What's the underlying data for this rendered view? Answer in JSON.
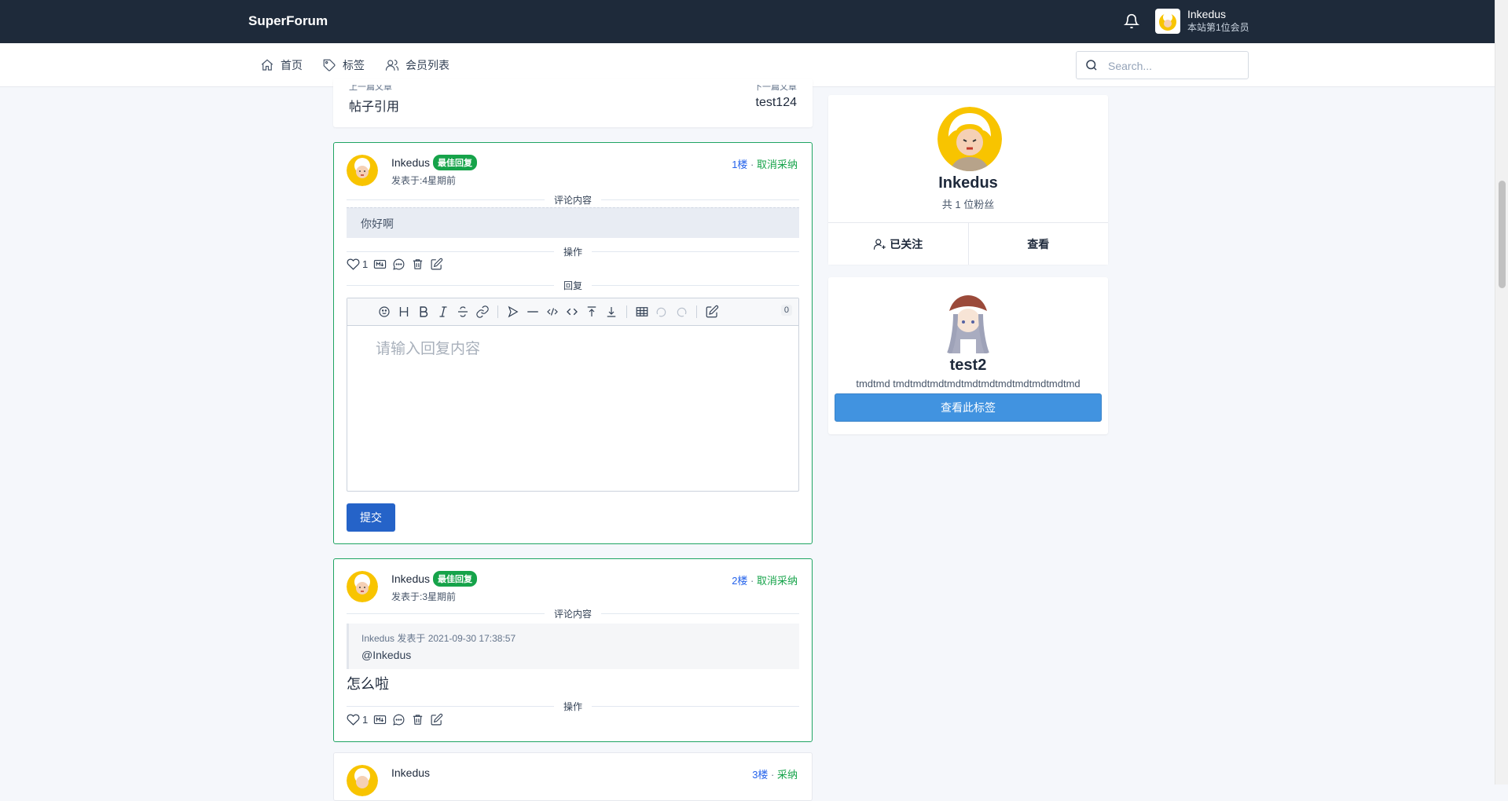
{
  "header": {
    "brand": "SuperForum",
    "user": {
      "name": "Inkedus",
      "subtitle": "本站第1位会员"
    }
  },
  "nav": {
    "items": [
      {
        "label": "首页",
        "icon": "home-icon"
      },
      {
        "label": "标签",
        "icon": "tag-icon"
      },
      {
        "label": "会员列表",
        "icon": "users-icon"
      }
    ],
    "search_placeholder": "Search..."
  },
  "article_nav": {
    "prev_label": "上一篇文章",
    "prev_title": "帖子引用",
    "next_label": "下一篇文章",
    "next_title": "test124"
  },
  "posts": [
    {
      "author": "Inkedus",
      "badge": "最佳回复",
      "time": "发表于:4星期前",
      "floor": "1楼",
      "sep": " · ",
      "action": "取消采纳",
      "content_label": "评论内容",
      "content": "你好啊",
      "ops_label": "操作",
      "likes": "1",
      "reply_label": "回复",
      "reply_placeholder": "请输入回复内容",
      "char_count": "0",
      "submit_label": "提交"
    },
    {
      "author": "Inkedus",
      "badge": "最佳回复",
      "time": "发表于:3星期前",
      "floor": "2楼",
      "sep": " · ",
      "action": "取消采纳",
      "content_label": "评论内容",
      "quote_meta": "Inkedus 发表于 2021-09-30 17:38:57",
      "quote_body": "@Inkedus",
      "content": "怎么啦",
      "ops_label": "操作",
      "likes": "1"
    },
    {
      "author": "Inkedus",
      "floor": "3楼",
      "sep": " · ",
      "action": "采纳"
    }
  ],
  "sidebar": {
    "profile": {
      "name": "Inkedus",
      "fans": "共 1 位粉丝",
      "follow_label": "已关注",
      "view_label": "查看"
    },
    "tag": {
      "name": "test2",
      "desc": "tmdtmd tmdtmdtmdtmdtmdtmdtmdtmdtmdtmdtmd",
      "button": "查看此标签"
    }
  },
  "colors": {
    "topbar": "#1e2a3a",
    "accent_green": "#16a34a",
    "link_blue": "#2563eb",
    "primary_button": "#2563c8",
    "tag_button": "#4193e0"
  }
}
